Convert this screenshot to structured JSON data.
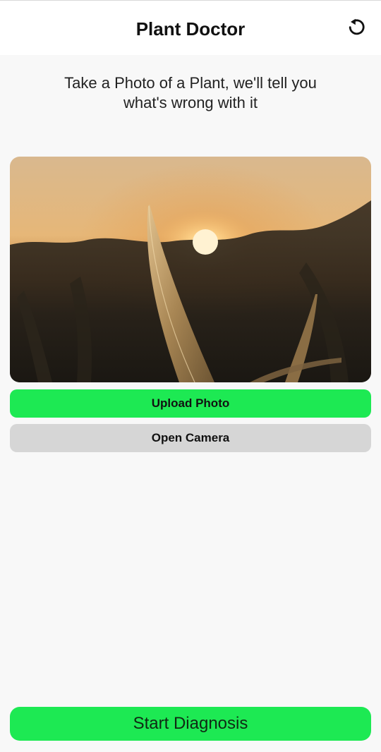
{
  "header": {
    "title": "Plant Doctor",
    "reset_icon": "refresh-icon"
  },
  "instructions": {
    "line1": "Take a Photo of a Plant, we'll tell you",
    "line2": "what's wrong with it"
  },
  "photo": {
    "icon": "plant-photo"
  },
  "actions": {
    "upload_label": "Upload Photo",
    "camera_label": "Open Camera",
    "diagnose_label": "Start Diagnosis"
  },
  "colors": {
    "accent": "#1de953",
    "secondary_button": "#d6d6d6",
    "background": "#f8f8f8"
  }
}
